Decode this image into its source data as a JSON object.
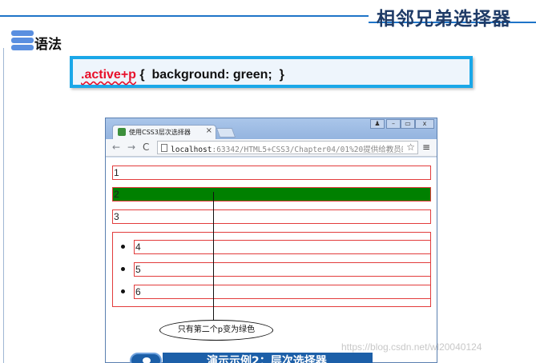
{
  "slide": {
    "title": "相邻兄弟选择器",
    "section_heading": "语法",
    "code": {
      "selector": ".active+p",
      "rest": " {  background: green;  }"
    }
  },
  "browser": {
    "tab_title": "使用CSS3层次选择器",
    "tab_close": "×",
    "window_buttons": [
      "♟",
      "–",
      "▭",
      "x"
    ],
    "nav": {
      "back": "←",
      "forward": "→",
      "reload": "C"
    },
    "url_host": "localhost",
    "url_rest": ":63342/HTML5+CSS3/Chapter04/01%20提供给教员的内",
    "star": "☆",
    "menu": "≡"
  },
  "page": {
    "paragraphs": [
      "1",
      "2",
      "3"
    ],
    "list_items": [
      "4",
      "5",
      "6"
    ],
    "callout": "只有第二个p变为绿色"
  },
  "banner": {
    "text": "演示示例2：层次选择器"
  },
  "watermark": "https://blog.csdn.net/wl20040124",
  "colors": {
    "accent_blue": "#1e74c8",
    "green": "#008000",
    "red_border": "#e23c3c",
    "code_border": "#1aa7e8"
  }
}
